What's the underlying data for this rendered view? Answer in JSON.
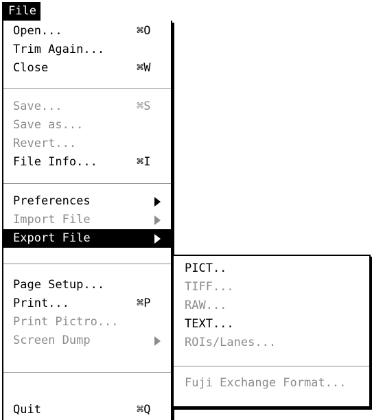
{
  "menu_title": "File",
  "file_menu": {
    "items": [
      {
        "label": "Open...",
        "shortcut": "⌘O"
      },
      {
        "label": "Trim Again...",
        "shortcut": ""
      },
      {
        "label": "Close",
        "shortcut": "⌘W"
      },
      {
        "label": "Save...",
        "shortcut": "⌘S",
        "disabled": true
      },
      {
        "label": "Save as...",
        "shortcut": "",
        "disabled": true
      },
      {
        "label": "Revert...",
        "shortcut": "",
        "disabled": true
      },
      {
        "label": "File Info...",
        "shortcut": "⌘I"
      },
      {
        "label": "Preferences",
        "submenu": true
      },
      {
        "label": "Import File",
        "submenu": true,
        "disabled": true
      },
      {
        "label": "Export File",
        "submenu": true,
        "highlighted": true
      },
      {
        "label": "Page Setup...",
        "shortcut": ""
      },
      {
        "label": "Print...",
        "shortcut": "⌘P"
      },
      {
        "label": "Print Pictro...",
        "shortcut": "",
        "disabled": true
      },
      {
        "label": "Screen Dump",
        "submenu": true,
        "disabled": true
      },
      {
        "label": "Quit",
        "shortcut": "⌘Q"
      }
    ]
  },
  "export_submenu": {
    "items": [
      {
        "label": "PICT..",
        "disabled": false
      },
      {
        "label": "TIFF...",
        "disabled": true
      },
      {
        "label": "RAW...",
        "disabled": true
      },
      {
        "label": "TEXT...",
        "disabled": false
      },
      {
        "label": "ROIs/Lanes...",
        "disabled": true
      },
      {
        "label": "Fuji Exchange Format...",
        "disabled": true
      }
    ]
  },
  "colors": {
    "text": "#000000",
    "disabled_text": "#8c8c8c",
    "highlight_bg": "#000000",
    "highlight_text": "#ffffff",
    "background": "#ffffff"
  }
}
